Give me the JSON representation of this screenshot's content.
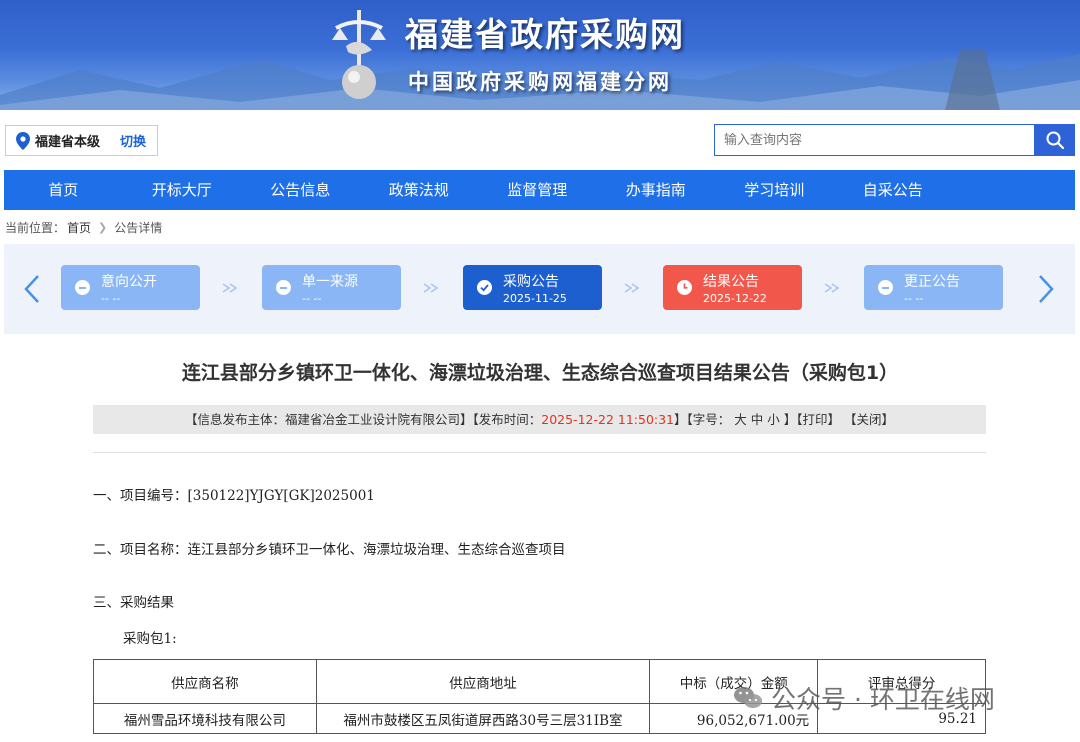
{
  "header": {
    "site_title": "福建省政府采购网",
    "site_subtitle": "中国政府采购网福建分网"
  },
  "location": {
    "region": "福建省本级",
    "switch_label": "切换"
  },
  "search": {
    "placeholder": "输入查询内容"
  },
  "nav": {
    "items": [
      "首页",
      "开标大厅",
      "公告信息",
      "政策法规",
      "监督管理",
      "办事指南",
      "学习培训",
      "自采公告"
    ]
  },
  "breadcrumb": {
    "prefix": "当前位置：",
    "home": "首页",
    "current": "公告详情"
  },
  "stages": [
    {
      "name": "意向公开",
      "date": "-- --",
      "state": "inactive"
    },
    {
      "name": "单一来源",
      "date": "-- --",
      "state": "inactive"
    },
    {
      "name": "采购公告",
      "date": "2025-11-25",
      "state": "done"
    },
    {
      "name": "结果公告",
      "date": "2025-12-22",
      "state": "current"
    },
    {
      "name": "更正公告",
      "date": "-- --",
      "state": "inactive"
    }
  ],
  "colors": {
    "nav": "#1f6fe8",
    "stage_inactive": "#8ab6f5",
    "stage_done": "#1e5fcf",
    "stage_current": "#f1584b",
    "publish_time": "#e8301c"
  },
  "article": {
    "title": "连江县部分乡镇环卫一体化、海漂垃圾治理、生态综合巡查项目结果公告（采购包1）",
    "meta": {
      "publisher_label": "【信息发布主体：",
      "publisher": "福建省冶金工业设计院有限公司",
      "publish_label": "】【发布时间：",
      "publish_time": "2025-12-22 11:50:31",
      "font_label": "】【字号：",
      "size_large": "大",
      "size_medium": "中",
      "size_small": "小",
      "print": "】【打印】",
      "close": "【关闭】"
    },
    "sections": {
      "project_no": "一、项目编号：[350122]YJGY[GK]2025001",
      "project_name": "二、项目名称：连江县部分乡镇环卫一体化、海漂垃圾治理、生态综合巡查项目",
      "result_heading": "三、采购结果",
      "package": "采购包1:"
    },
    "table": {
      "headers": [
        "供应商名称",
        "供应商地址",
        "中标（成交）金额",
        "评审总得分"
      ],
      "rows": [
        [
          "福州雪品环境科技有限公司",
          "福州市鼓楼区五凤街道屏西路30号三层31IB室",
          "96,052,671.00元",
          "95.21"
        ]
      ]
    }
  },
  "watermark": "公众号 · 环卫在线网"
}
